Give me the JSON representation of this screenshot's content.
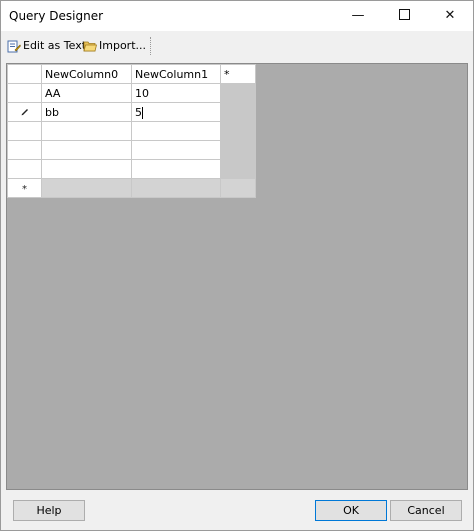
{
  "window": {
    "title": "Query Designer"
  },
  "toolbar": {
    "edit_as_text_label": "Edit as Text",
    "import_label": "Import...",
    "edit_icon": "edit-text-icon",
    "import_icon": "folder-open-icon"
  },
  "grid": {
    "columns": [
      "NewColumn0",
      "NewColumn1",
      "*"
    ],
    "rows": [
      {
        "selector": "",
        "cells": [
          "AA",
          "10"
        ]
      },
      {
        "selector": "pencil",
        "cells": [
          "bb",
          "5"
        ]
      },
      {
        "selector": "",
        "cells": [
          "",
          ""
        ]
      },
      {
        "selector": "",
        "cells": [
          "",
          ""
        ]
      },
      {
        "selector": "",
        "cells": [
          "",
          ""
        ]
      }
    ],
    "new_row_marker": "*"
  },
  "buttons": {
    "help": "Help",
    "ok": "OK",
    "cancel": "Cancel"
  }
}
